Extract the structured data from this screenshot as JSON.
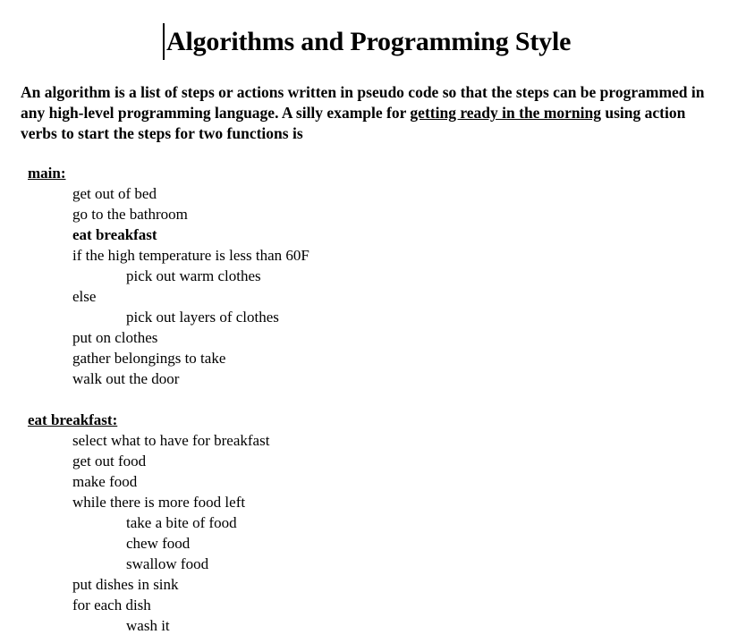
{
  "document": {
    "title": "Algorithms and Programming Style",
    "caret_visible": true
  },
  "intro": {
    "part1": "An algorithm is a list of steps or actions written in pseudo code so that the steps can be programmed in any high-level  programming language. A silly example for ",
    "emphasis": "getting ready in the morning",
    "part2": " using action verbs to start the steps for two functions is"
  },
  "blocks": [
    {
      "header": "main:",
      "lines": [
        {
          "text": "get out of bed",
          "level": 1,
          "bold": false
        },
        {
          "text": "go to the bathroom",
          "level": 1,
          "bold": false
        },
        {
          "text": "eat breakfast",
          "level": 1,
          "bold": true
        },
        {
          "text": "if the high temperature is less than 60F",
          "level": 1,
          "bold": false
        },
        {
          "text": "pick out warm clothes",
          "level": 2,
          "bold": false
        },
        {
          "text": "else",
          "level": 1,
          "bold": false
        },
        {
          "text": "pick out layers of clothes",
          "level": 2,
          "bold": false
        },
        {
          "text": "put on clothes",
          "level": 1,
          "bold": false
        },
        {
          "text": "gather belongings to take",
          "level": 1,
          "bold": false
        },
        {
          "text": "walk out the door",
          "level": 1,
          "bold": false
        }
      ]
    },
    {
      "header": "eat breakfast:",
      "lines": [
        {
          "text": "select what to have for breakfast",
          "level": 1,
          "bold": false
        },
        {
          "text": "get out food",
          "level": 1,
          "bold": false
        },
        {
          "text": "make food",
          "level": 1,
          "bold": false
        },
        {
          "text": "while there is more food left",
          "level": 1,
          "bold": false
        },
        {
          "text": "take a bite of food",
          "level": 2,
          "bold": false
        },
        {
          "text": "chew food",
          "level": 2,
          "bold": false
        },
        {
          "text": "swallow food",
          "level": 2,
          "bold": false
        },
        {
          "text": "put dishes in sink",
          "level": 1,
          "bold": false
        },
        {
          "text": "for each dish",
          "level": 1,
          "bold": false
        },
        {
          "text": "wash it",
          "level": 2,
          "bold": false
        }
      ]
    }
  ]
}
